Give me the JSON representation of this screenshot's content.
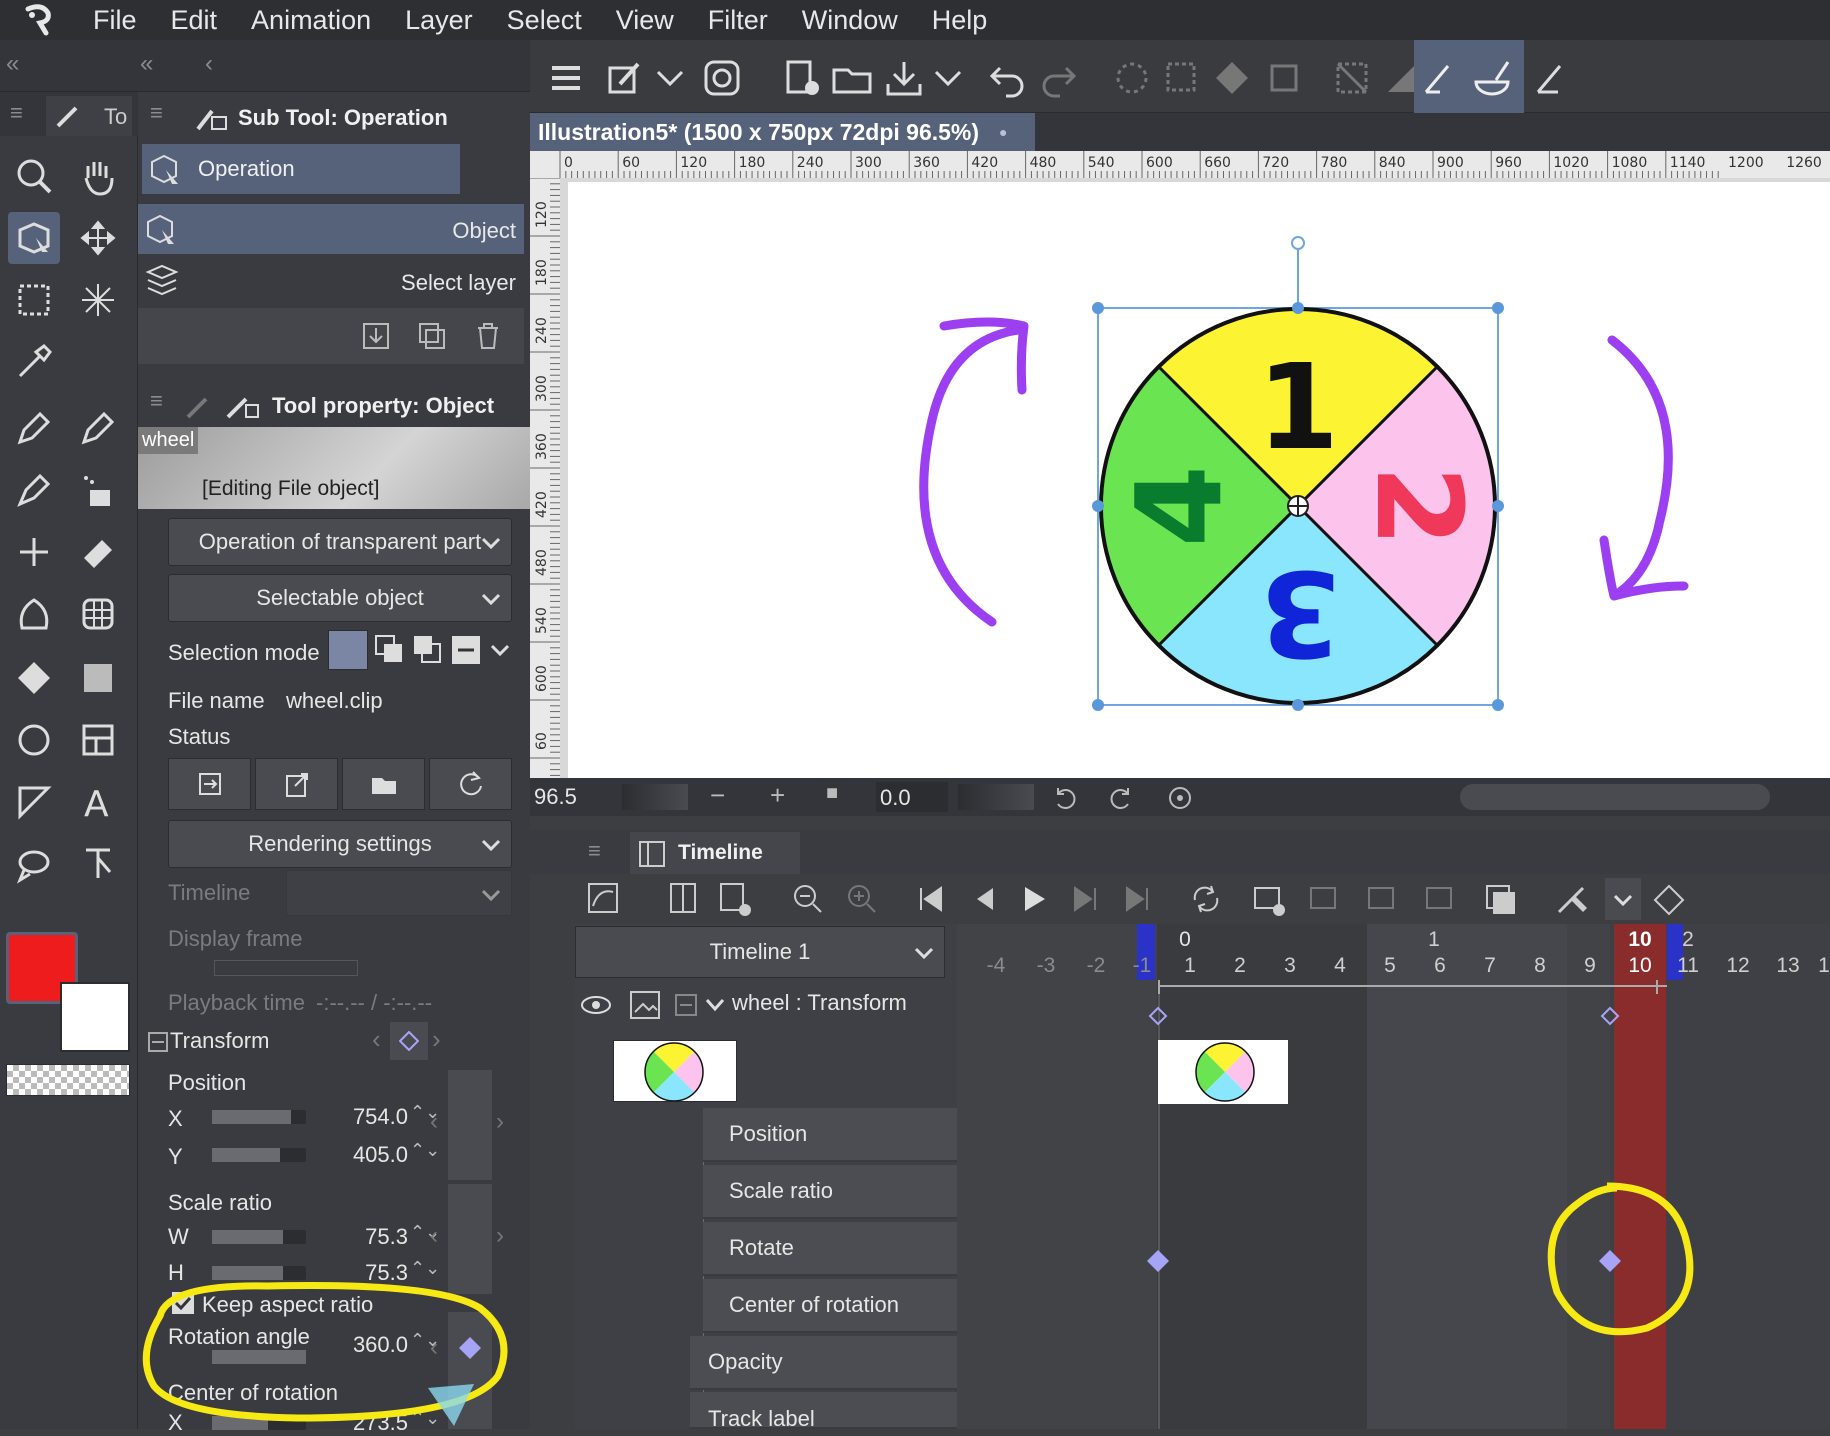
{
  "menu": [
    "File",
    "Edit",
    "Animation",
    "Layer",
    "Select",
    "View",
    "Filter",
    "Window",
    "Help"
  ],
  "tool_tab": {
    "label": "To"
  },
  "subtool": {
    "title": "Sub Tool: Operation",
    "group": "Operation",
    "items": [
      "Object",
      "Select layer"
    ]
  },
  "tool_property": {
    "title": "Tool property: Object",
    "preview_name": "wheel",
    "preview_caption": "[Editing File object]",
    "transparent_part": "Operation of transparent part",
    "selectable": "Selectable object",
    "selection_mode_label": "Selection mode",
    "file_name_label": "File name",
    "file_name_value": "wheel.clip",
    "status_label": "Status",
    "rendering": "Rendering settings",
    "timeline_label": "Timeline",
    "display_frame_label": "Display frame",
    "playback_time_label": "Playback time",
    "playback_time_value": "-:--.-- / -:--.--",
    "transform_label": "Transform",
    "position_label": "Position",
    "x_label": "X",
    "x_value": "754.0",
    "y_label": "Y",
    "y_value": "405.0",
    "scale_label": "Scale ratio",
    "w_label": "W",
    "w_value": "75.3",
    "h_label": "H",
    "h_value": "75.3",
    "keep_aspect": "Keep aspect ratio",
    "rotation_label": "Rotation angle",
    "rotation_value": "360.0",
    "center_label": "Center of rotation",
    "cx_label": "X",
    "cx_value": "273.5"
  },
  "document": {
    "tab_title": "Illustration5* (1500 x 750px 72dpi 96.5%)",
    "ruler_top": [
      "0",
      "60",
      "120",
      "180",
      "240",
      "300",
      "360",
      "420",
      "480",
      "540",
      "600",
      "660",
      "720",
      "780",
      "840",
      "900",
      "960",
      "1020",
      "1080",
      "1140",
      "1200",
      "1260"
    ],
    "ruler_left": [
      "120",
      "180",
      "240",
      "300",
      "360",
      "420",
      "480",
      "540",
      "600",
      "60"
    ],
    "wheel_numbers": [
      "1",
      "2",
      "3",
      "4"
    ]
  },
  "navigator": {
    "zoom": "96.5",
    "angle": "0.0"
  },
  "timeline": {
    "title": "Timeline",
    "selector": "Timeline 1",
    "track_name": "wheel : Transform",
    "rows": [
      "Position",
      "Scale ratio",
      "Rotate",
      "Center of rotation"
    ],
    "opacity": "Opacity",
    "track_label": "Track label",
    "top_markers": [
      "0",
      "1",
      "10",
      "2"
    ],
    "frames": [
      "-4",
      "-3",
      "-2",
      "-1",
      "1",
      "2",
      "3",
      "4",
      "5",
      "6",
      "7",
      "8",
      "9",
      "10",
      "11",
      "12",
      "13",
      "1"
    ]
  },
  "colors": {
    "accent": "#55627a",
    "main_color": "#ee1c1c",
    "sub_color": "#ffffff",
    "annotation_yellow": "#f7ea14",
    "annotation_purple": "#9b3ff0",
    "wheel_yellow": "#fcf432",
    "wheel_pink": "#fcc4ec",
    "wheel_blue": "#8ae6fc",
    "wheel_green": "#6ae450",
    "keyframe": "#a7a4f7",
    "current_frame": "#8a2c2c"
  }
}
